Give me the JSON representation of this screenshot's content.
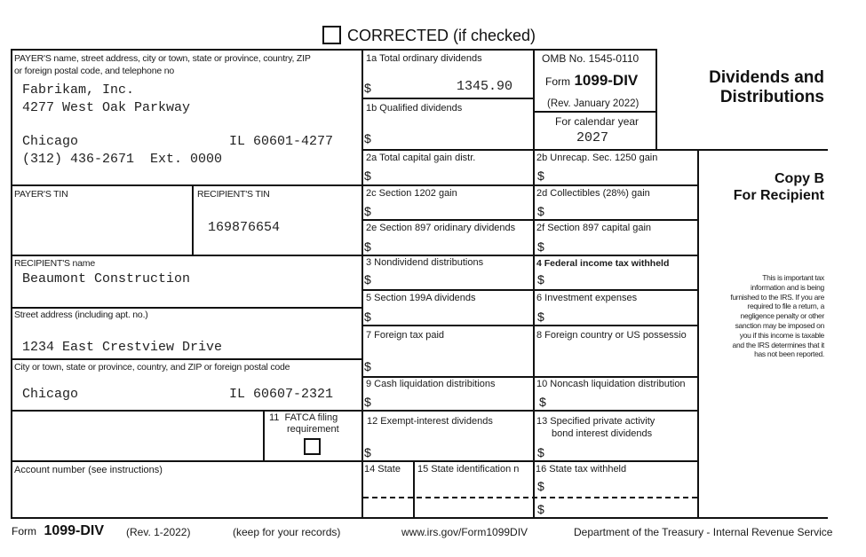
{
  "header": {
    "corrected_label": "CORRECTED (if checked)",
    "corrected_checked": false
  },
  "payer": {
    "label_line1": "PAYER'S name, street address, city or town, state or province, country, ZIP",
    "label_line2": "or foreign postal code, and telephone no",
    "name": "Fabrikam, Inc.",
    "street": "4277 West Oak Parkway",
    "city": "Chicago",
    "state_zip": "IL 60601-4277",
    "phone": "(312) 436-2671  Ext. 0000"
  },
  "omb": {
    "omb_no": "OMB No. 1545-0110",
    "form_prefix": "Form",
    "form_name": "1099-DIV",
    "rev": "(Rev. January 2022)",
    "calendar_label": "For calendar year",
    "year": "2027"
  },
  "title": {
    "line1": "Dividends and",
    "line2": "Distributions",
    "copy_line1": "Copy B",
    "copy_line2": "For Recipient",
    "notice": [
      "This is important tax",
      "information and is being",
      "furnished to the IRS. If you are",
      "required to file a return, a",
      "negligence penalty or other",
      "sanction may be imposed on",
      "you if this income is taxable",
      "and the IRS determines that it",
      "has not been reported."
    ]
  },
  "tins": {
    "payer_tin_label": "PAYER'S TIN",
    "payer_tin": "",
    "recipient_tin_label": "RECIPIENT'S TIN",
    "recipient_tin": "169876654"
  },
  "recipient": {
    "name_label": "RECIPIENT'S name",
    "name": "Beaumont Construction",
    "street_label": "Street address (including apt. no.)",
    "street": "1234 East Crestview Drive",
    "city_label": "City or town, state or province, country, and ZIP or foreign postal code",
    "city": "Chicago",
    "state_zip": "IL 60607-2321"
  },
  "fatca": {
    "label_line1": "11  FATCA filing",
    "label_line2": "requirement",
    "checked": false
  },
  "account": {
    "label": "Account number (see instructions)",
    "value": ""
  },
  "currency_symbol": "$",
  "boxes": {
    "b1a": {
      "label": "1a Total ordinary dividends",
      "value": "1345.90"
    },
    "b1b": {
      "label": "1b Qualified dividends",
      "value": ""
    },
    "b2a": {
      "label": "2a Total capital gain distr.",
      "value": ""
    },
    "b2b": {
      "label": "2b Unrecap. Sec. 1250 gain",
      "value": ""
    },
    "b2c": {
      "label": "2c Section 1202 gain",
      "value": ""
    },
    "b2d": {
      "label": "2d Collectibles (28%) gain",
      "value": ""
    },
    "b2e": {
      "label": "2e Section 897 oridinary dividends",
      "value": ""
    },
    "b2f": {
      "label": "2f Section 897 capital gain",
      "value": ""
    },
    "b3": {
      "label": "3 Nondividend distributions",
      "value": ""
    },
    "b4": {
      "label": "4 Federal income tax withheld",
      "value": ""
    },
    "b5": {
      "label": "5 Section 199A dividends",
      "value": ""
    },
    "b6": {
      "label": "6 Investment expenses",
      "value": ""
    },
    "b7": {
      "label": "7 Foreign tax paid",
      "value": ""
    },
    "b8": {
      "label": "8 Foreign country or US possessio",
      "value": ""
    },
    "b9": {
      "label": "9 Cash liquidation distribitions",
      "value": ""
    },
    "b10": {
      "label": "10 Noncash liquidation distribution",
      "value": ""
    },
    "b12": {
      "label": "12 Exempt-interest dividends",
      "value": ""
    },
    "b13": {
      "label_line1": "13 Specified private activity",
      "label_line2": "bond interest dividends",
      "value": ""
    },
    "b14": {
      "label": "14 State",
      "value": ""
    },
    "b15": {
      "label": "15 State identification n",
      "value": ""
    },
    "b16": {
      "label": "16 State tax withheld",
      "value": ""
    }
  },
  "footer": {
    "form_prefix": "Form",
    "form_name": "1099-DIV",
    "rev": "(Rev. 1-2022)",
    "keep": "(keep for your records)",
    "url": "www.irs.gov/Form1099DIV",
    "dept": "Department of the Treasury - Internal Revenue Service"
  }
}
